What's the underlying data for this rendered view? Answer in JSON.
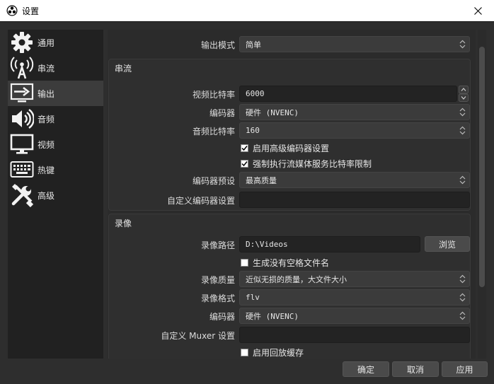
{
  "window": {
    "title": "设置",
    "close_glyph": "✕"
  },
  "sidebar": {
    "items": [
      {
        "label": "通用",
        "icon": "gear-icon"
      },
      {
        "label": "串流",
        "icon": "broadcast-icon"
      },
      {
        "label": "输出",
        "icon": "output-icon",
        "active": true
      },
      {
        "label": "音频",
        "icon": "speaker-icon"
      },
      {
        "label": "视频",
        "icon": "monitor-icon"
      },
      {
        "label": "热键",
        "icon": "keyboard-icon"
      },
      {
        "label": "高级",
        "icon": "tools-icon"
      }
    ]
  },
  "output_mode": {
    "label": "输出模式",
    "value": "简单"
  },
  "streaming": {
    "title": "串流",
    "video_bitrate": {
      "label": "视频比特率",
      "value": "6000"
    },
    "encoder": {
      "label": "编码器",
      "value": "硬件 (NVENC)"
    },
    "audio_bitrate": {
      "label": "音频比特率",
      "value": "160"
    },
    "advanced_encoder": {
      "label": "启用高级编码器设置",
      "checked": true
    },
    "enforce_limits": {
      "label": "强制执行流媒体服务比特率限制",
      "checked": true
    },
    "encoder_preset": {
      "label": "编码器预设",
      "value": "最高质量"
    },
    "custom_encoder": {
      "label": "自定义编码器设置",
      "value": ""
    }
  },
  "recording": {
    "title": "录像",
    "path": {
      "label": "录像路径",
      "value": "D:\\Videos",
      "browse": "浏览"
    },
    "no_space": {
      "label": "生成没有空格文件名",
      "checked": false
    },
    "quality": {
      "label": "录像质量",
      "value": "近似无损的质量，大文件大小"
    },
    "format": {
      "label": "录像格式",
      "value": "flv"
    },
    "encoder": {
      "label": "编码器",
      "value": "硬件 (NVENC)"
    },
    "muxer": {
      "label": "自定义 Muxer 设置",
      "value": ""
    },
    "replay_buffer": {
      "label": "启用回放缓存",
      "checked": false
    }
  },
  "buttons": {
    "ok": "确定",
    "cancel": "取消",
    "apply": "应用"
  },
  "colors": {
    "background": "#2e2e2e",
    "sidebar": "#212121",
    "active": "#3c3c3c",
    "field": "#232323",
    "combo": "#3b3b3b"
  }
}
